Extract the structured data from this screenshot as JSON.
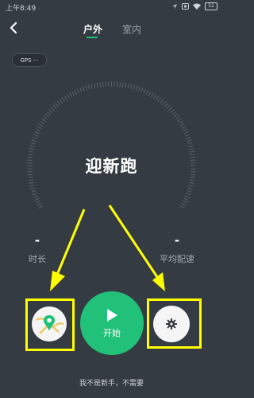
{
  "status_bar": {
    "time": "上午8:49",
    "battery": "52"
  },
  "header": {
    "tabs": [
      {
        "label": "户外",
        "active": true
      },
      {
        "label": "室内",
        "active": false
      }
    ]
  },
  "gps_badge": "GPS ···",
  "title": "迎新跑",
  "stats": [
    {
      "value": "-",
      "label": "时长"
    },
    {
      "value": "-",
      "label": "平均配速"
    }
  ],
  "controls": {
    "start_label": "开始"
  },
  "footer": {
    "skip_text": "我不是新手，不需要"
  },
  "colors": {
    "background": "#353b42",
    "accent": "#21c17a",
    "annotation": "#ffff00"
  },
  "icons": [
    "back-icon",
    "map-pin-icon",
    "play-icon",
    "gear-icon"
  ]
}
